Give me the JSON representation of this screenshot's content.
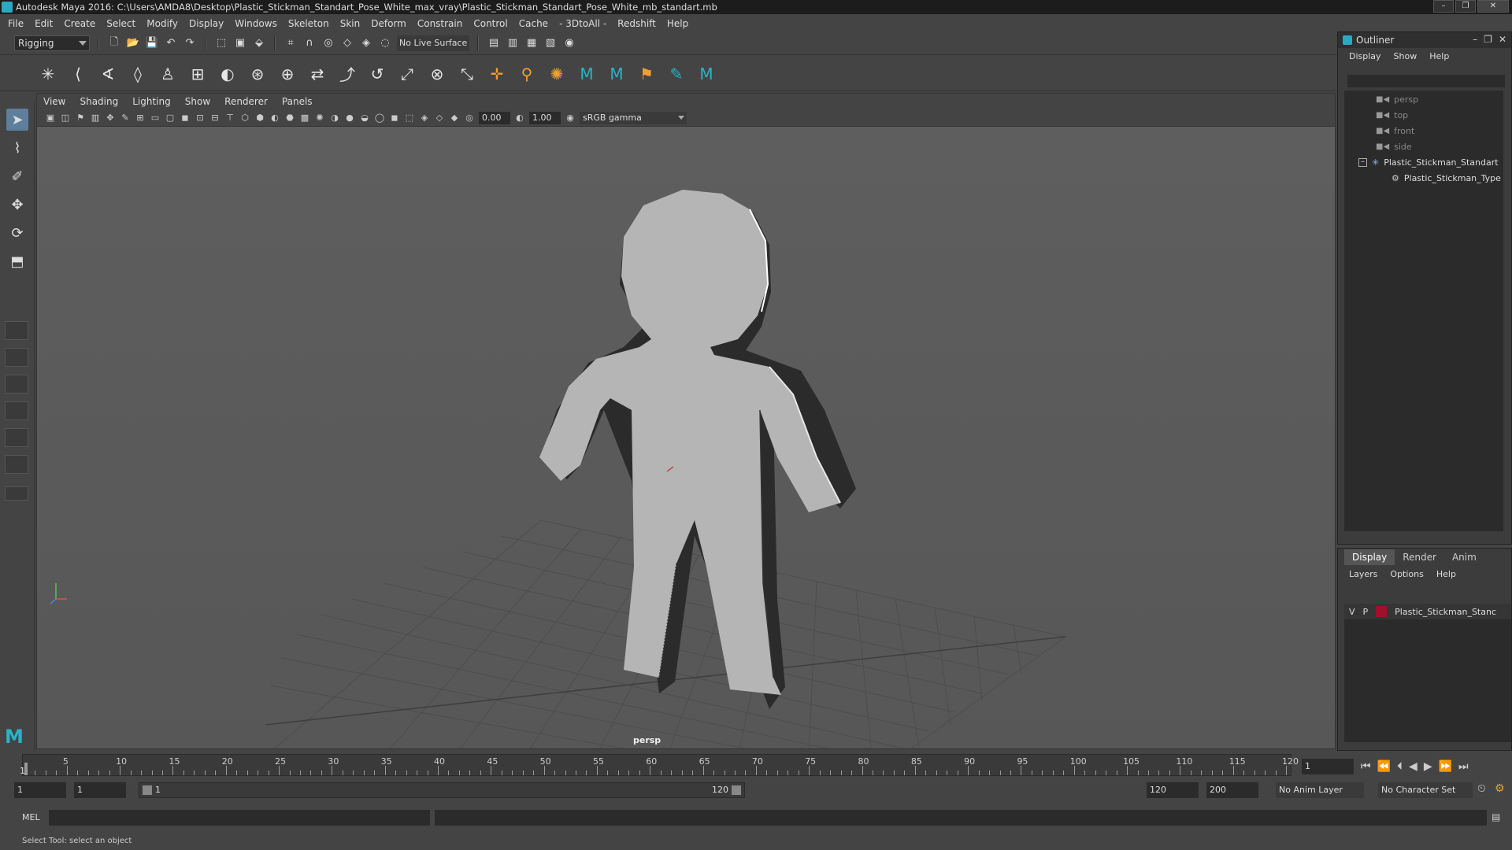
{
  "window": {
    "title": "Autodesk Maya 2016: C:\\Users\\AMDA8\\Desktop\\Plastic_Stickman_Standart_Pose_White_max_vray\\Plastic_Stickman_Standart_Pose_White_mb_standart.mb",
    "minimize": "–",
    "maximize": "❐",
    "close": "✕"
  },
  "menubar": [
    "File",
    "Edit",
    "Create",
    "Select",
    "Modify",
    "Display",
    "Windows",
    "Skeleton",
    "Skin",
    "Deform",
    "Constrain",
    "Control",
    "Cache",
    "- 3DtoAll -",
    "Redshift",
    "Help"
  ],
  "statusline": {
    "module": "Rigging",
    "live_surface": "No Live Surface"
  },
  "viewport": {
    "menu": [
      "View",
      "Shading",
      "Lighting",
      "Show",
      "Renderer",
      "Panels"
    ],
    "exposure": "0.00",
    "gamma": "1.00",
    "color_space": "sRGB gamma",
    "camera_label": "persp",
    "object_color": "#b5b5b5",
    "background_color": "#5d5d5d"
  },
  "outliner": {
    "title": "Outliner",
    "menu": [
      "Display",
      "Show",
      "Help"
    ],
    "items": [
      {
        "label": "persp",
        "dim": true
      },
      {
        "label": "top",
        "dim": true
      },
      {
        "label": "front",
        "dim": true
      },
      {
        "label": "side",
        "dim": true
      },
      {
        "label": "Plastic_Stickman_Standart",
        "dim": false
      },
      {
        "label": "Plastic_Stickman_Type",
        "dim": false
      }
    ]
  },
  "layers": {
    "tabs": [
      "Display",
      "Render",
      "Anim"
    ],
    "active_tab": "Display",
    "menu": [
      "Layers",
      "Options",
      "Help"
    ],
    "rows": [
      {
        "visible": "V",
        "playback": "P",
        "name": "Plastic_Stickman_Stanc",
        "color": "#a0102a"
      }
    ]
  },
  "timeline": {
    "ticks": [
      5,
      10,
      15,
      20,
      25,
      30,
      35,
      40,
      45,
      50,
      55,
      60,
      65,
      70,
      75,
      80,
      85,
      90,
      95,
      100,
      105,
      110,
      115,
      120
    ],
    "current_frame": "1",
    "start_marker": "1"
  },
  "range": {
    "start": "1",
    "playback_start": "1",
    "slider_start": "1",
    "slider_end": "120",
    "playback_end": "120",
    "end": "200",
    "anim_layer": "No Anim Layer",
    "character_set": "No Character Set"
  },
  "command": {
    "label": "MEL"
  },
  "help": {
    "text": "Select Tool: select an object"
  }
}
